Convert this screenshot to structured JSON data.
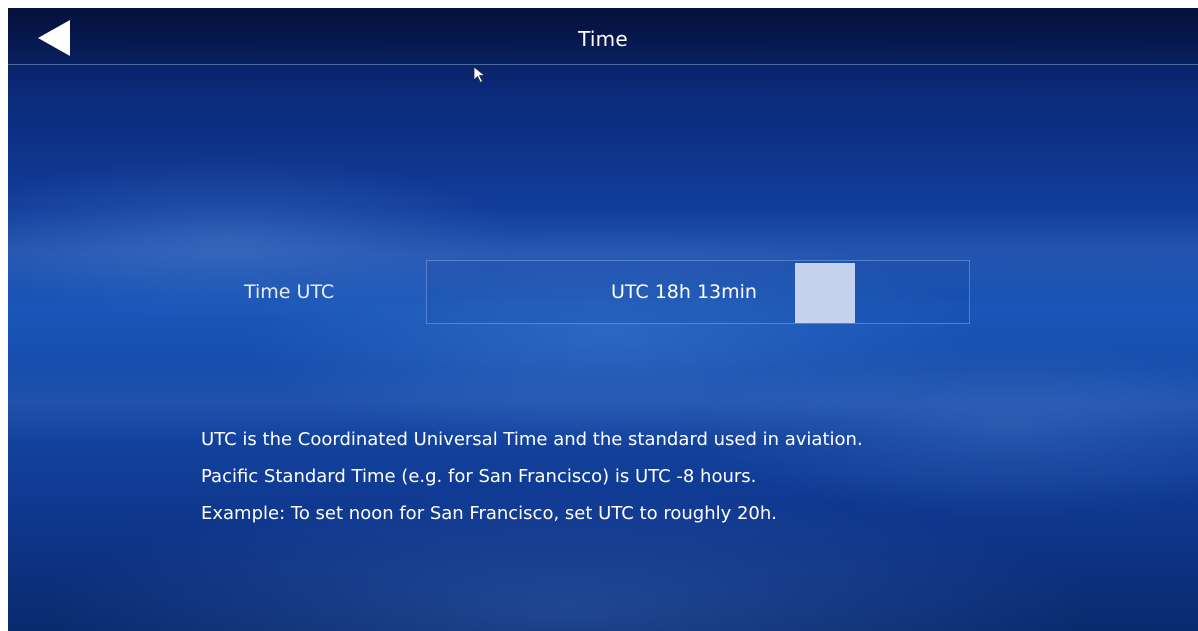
{
  "header": {
    "title": "Time",
    "back_icon": "back-arrow-icon"
  },
  "time_setting": {
    "label": "Time UTC",
    "value": "UTC 18h 13min"
  },
  "info": {
    "lines": [
      "UTC is the Coordinated Universal Time and the standard used in aviation.",
      "Pacific Standard Time (e.g. for San Francisco) is UTC -8 hours.",
      "Example: To set noon for San Francisco, set UTC to roughly 20h."
    ]
  },
  "colors": {
    "background_top": "#06164a",
    "background_mid": "#1a56b8",
    "text": "#ffffff",
    "caret": "#c6d3ef"
  }
}
